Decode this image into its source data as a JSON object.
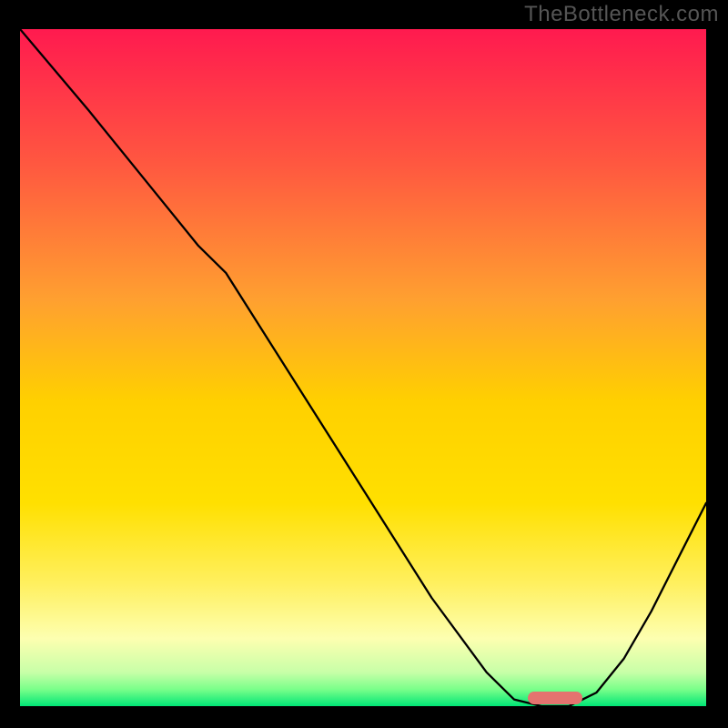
{
  "watermark": "TheBottleneck.com",
  "colors": {
    "border": "#000000",
    "curve": "#000000",
    "marker": "#e4736f",
    "gradient_stops": [
      {
        "offset": 0.0,
        "color": "#ff1a4f"
      },
      {
        "offset": 0.2,
        "color": "#ff5840"
      },
      {
        "offset": 0.4,
        "color": "#ffa030"
      },
      {
        "offset": 0.55,
        "color": "#ffd000"
      },
      {
        "offset": 0.7,
        "color": "#ffe000"
      },
      {
        "offset": 0.82,
        "color": "#fff060"
      },
      {
        "offset": 0.9,
        "color": "#fdffb0"
      },
      {
        "offset": 0.95,
        "color": "#c8ffa8"
      },
      {
        "offset": 0.975,
        "color": "#7aff8a"
      },
      {
        "offset": 1.0,
        "color": "#00e676"
      }
    ]
  },
  "chart_data": {
    "type": "line",
    "title": "",
    "xlabel": "",
    "ylabel": "",
    "xlim": [
      0,
      100
    ],
    "ylim": [
      0,
      100
    ],
    "series": [
      {
        "name": "curve",
        "x": [
          0,
          5,
          10,
          18,
          26,
          30,
          40,
          50,
          60,
          68,
          72,
          76,
          80,
          84,
          88,
          92,
          96,
          100
        ],
        "y": [
          100,
          94,
          88,
          78,
          68,
          64,
          48,
          32,
          16,
          5,
          1,
          0,
          0,
          2,
          7,
          14,
          22,
          30
        ]
      }
    ],
    "marker": {
      "x_center": 78,
      "y": 0,
      "width_pct": 8
    }
  }
}
